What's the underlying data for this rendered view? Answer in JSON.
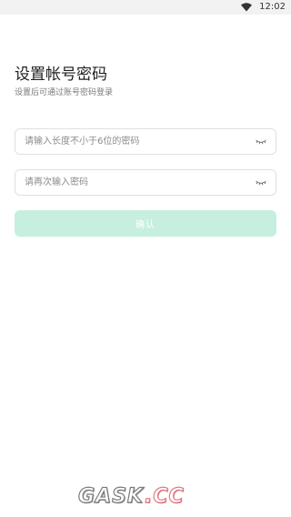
{
  "status_bar": {
    "time": "12:02",
    "icon": "wifi-icon"
  },
  "header": {
    "title": "设置帐号密码",
    "subtitle": "设置后可通过账号密码登录"
  },
  "form": {
    "password": {
      "placeholder": "请输入长度不小于6位的密码",
      "value": "",
      "toggle_icon": "eye-closed-icon"
    },
    "confirm_password": {
      "placeholder": "请再次输入密码",
      "value": "",
      "toggle_icon": "eye-closed-icon"
    },
    "confirm_label": "确认"
  },
  "watermark": {
    "text_main": "GASK",
    "text_accent": ".CC"
  },
  "colors": {
    "button_disabled": "#c6efdf",
    "field_border": "#e0e0e0",
    "status_bar_bg": "#f2f2f2",
    "watermark_accent": "#e07a86"
  }
}
